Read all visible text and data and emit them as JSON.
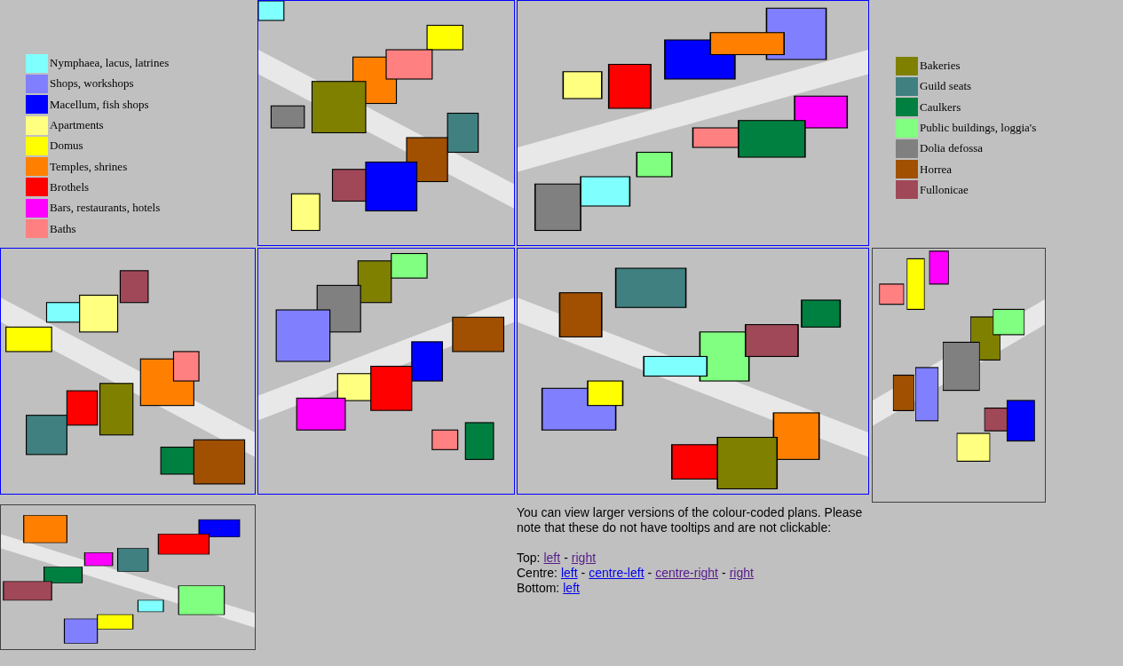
{
  "legend_left": [
    {
      "label": "Nymphaea, lacus, latrines",
      "color": "#80ffff"
    },
    {
      "label": "Shops, workshops",
      "color": "#8080ff"
    },
    {
      "label": "Macellum, fish shops",
      "color": "#0000ff"
    },
    {
      "label": "Apartments",
      "color": "#ffff80"
    },
    {
      "label": "Domus",
      "color": "#ffff00"
    },
    {
      "label": "Temples, shrines",
      "color": "#ff8000"
    },
    {
      "label": "Brothels",
      "color": "#ff0000"
    },
    {
      "label": "Bars, restaurants, hotels",
      "color": "#ff00ff"
    },
    {
      "label": "Baths",
      "color": "#ff8080"
    }
  ],
  "legend_right": [
    {
      "label": "Bakeries",
      "color": "#808000"
    },
    {
      "label": "Guild seats",
      "color": "#408080"
    },
    {
      "label": "Caulkers",
      "color": "#008040"
    },
    {
      "label": "Public buildings, loggia's",
      "color": "#80ff80"
    },
    {
      "label": "Dolia defossa",
      "color": "#808080"
    },
    {
      "label": "Horrea",
      "color": "#a05000"
    },
    {
      "label": "Fullonicae",
      "color": "#a04858"
    }
  ],
  "tiles": [
    {
      "kind": "picture",
      "linked": true
    },
    {
      "kind": "picture",
      "linked": true
    },
    {
      "kind": "picture",
      "linked": true
    },
    {
      "kind": "picture",
      "linked": true
    },
    {
      "kind": "picture",
      "linked": true
    },
    {
      "kind": "picture",
      "linked": false
    },
    {
      "kind": "picture",
      "linked": false
    }
  ],
  "note": {
    "text": "You can view larger versions of the colour-coded plans. Please note that these do not have tooltips and are not clickable:",
    "link_rows": [
      {
        "label": "Top:",
        "items": [
          {
            "kind": "link",
            "text": "left",
            "visited": true
          },
          {
            "kind": "text",
            "text": "-"
          },
          {
            "kind": "link",
            "text": "right",
            "visited": true
          }
        ]
      },
      {
        "label": "Centre:",
        "items": [
          {
            "kind": "link",
            "text": "left",
            "visited": false
          },
          {
            "kind": "text",
            "text": "-"
          },
          {
            "kind": "link",
            "text": "centre-left",
            "visited": false
          },
          {
            "kind": "text",
            "text": "-"
          },
          {
            "kind": "link",
            "text": "centre-right",
            "visited": true
          },
          {
            "kind": "text",
            "text": "-"
          },
          {
            "kind": "link",
            "text": "right",
            "visited": true
          }
        ]
      },
      {
        "label": "Bottom:",
        "items": [
          {
            "kind": "link",
            "text": "left",
            "visited": false
          }
        ]
      }
    ]
  }
}
